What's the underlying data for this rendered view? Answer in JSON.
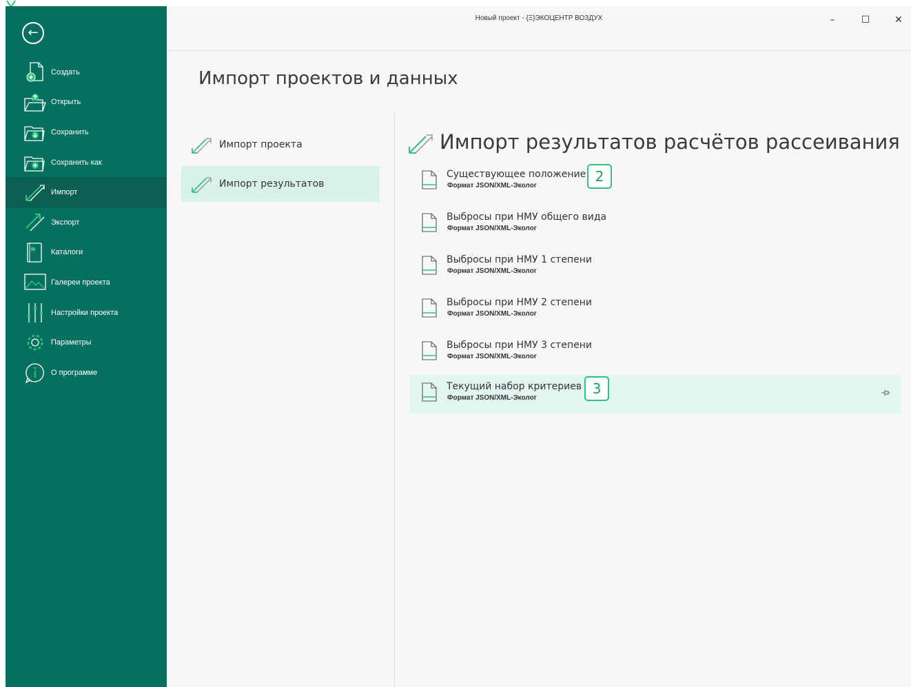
{
  "window": {
    "title": "Новый проект - {Ξ}ЭКОЦЕНТР ВОЗДУХ",
    "minimize": "–",
    "maximize": "☐",
    "close": "✕"
  },
  "sidebar": {
    "back_icon": "←",
    "items": [
      {
        "label": "Создать",
        "icon": "new-file-icon"
      },
      {
        "label": "Открыть",
        "icon": "open-folder-icon"
      },
      {
        "label": "Сохранить",
        "icon": "save-icon"
      },
      {
        "label": "Сохранить как",
        "icon": "save-as-icon"
      },
      {
        "label": "Импорт",
        "icon": "import-icon",
        "active": true
      },
      {
        "label": "Экспорт",
        "icon": "export-icon"
      },
      {
        "label": "Каталоги",
        "icon": "catalog-icon"
      },
      {
        "label": "Галереи проекта",
        "icon": "gallery-icon"
      },
      {
        "label": "Настройки проекта",
        "icon": "settings-sliders-icon"
      },
      {
        "label": "Параметры",
        "icon": "gear-icon"
      },
      {
        "label": "О программе",
        "icon": "info-icon"
      }
    ]
  },
  "page": {
    "title": "Импорт проектов и данных"
  },
  "subnav": {
    "items": [
      {
        "label": "Импорт проекта"
      },
      {
        "label": "Импорт результатов",
        "active": true
      }
    ]
  },
  "section": {
    "title": "Импорт результатов расчётов рассеивания",
    "items": [
      {
        "title": "Существующее положение",
        "subtitle": "Формат JSON/XML-Эколог",
        "badge": "2"
      },
      {
        "title": "Выбросы при НМУ общего вида",
        "subtitle": "Формат JSON/XML-Эколог"
      },
      {
        "title": "Выбросы при НМУ 1 степени",
        "subtitle": "Формат JSON/XML-Эколог"
      },
      {
        "title": "Выбросы при НМУ 2 степени",
        "subtitle": "Формат JSON/XML-Эколог"
      },
      {
        "title": "Выбросы при НМУ 3 степени",
        "subtitle": "Формат JSON/XML-Эколог"
      },
      {
        "title": "Текущий набор критериев",
        "subtitle": "Формат JSON/XML-Эколог",
        "badge": "3",
        "active": true
      }
    ]
  },
  "colors": {
    "sidebar_bg": "#06705f",
    "sidebar_active": "#0a5f52",
    "accent_green": "#2ec27e",
    "selected_bg": "#d8f2ea"
  }
}
